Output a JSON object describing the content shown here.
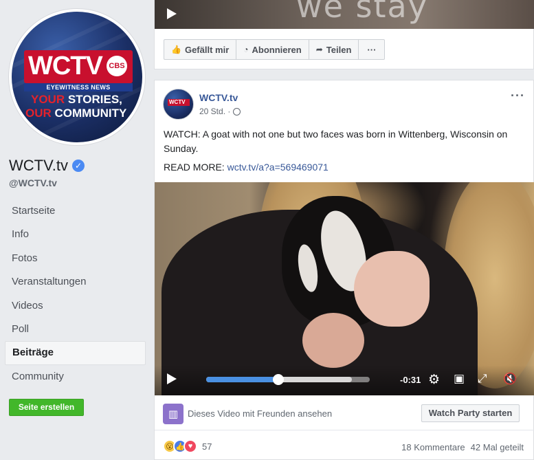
{
  "sidebar": {
    "logo": {
      "brand": "WCTV",
      "network": "CBS",
      "subtitle": "EYEWITNESS NEWS",
      "tagline_1_accent": "YOUR",
      "tagline_1_rest": " STORIES,",
      "tagline_2_accent": "OUR",
      "tagline_2_rest": " COMMUNITY"
    },
    "page_name": "WCTV.tv",
    "handle": "@WCTV.tv",
    "nav": [
      {
        "label": "Startseite"
      },
      {
        "label": "Info"
      },
      {
        "label": "Fotos"
      },
      {
        "label": "Veranstaltungen"
      },
      {
        "label": "Videos"
      },
      {
        "label": "Poll"
      },
      {
        "label": "Beiträge",
        "active": true
      },
      {
        "label": "Community"
      }
    ],
    "create_button": "Seite erstellen"
  },
  "top_card": {
    "video_caption": "we stay",
    "actions": {
      "like": "Gefällt mir",
      "subscribe": "Abonnieren",
      "share": "Teilen",
      "more": "···"
    }
  },
  "post": {
    "author": "WCTV.tv",
    "time": "20 Std. ·",
    "more": "···",
    "text": "WATCH: A goat with not one but two faces was born in Wittenberg, Wisconsin on Sunday.",
    "read_more_label": "READ MORE: ",
    "read_more_link": "wctv.tv/a?a=569469071",
    "video": {
      "time_remaining": "-0:31",
      "progress": 0.44,
      "buffered": 0.89
    },
    "watch_party": {
      "text": "Dieses Video mit Freunden ansehen",
      "button": "Watch Party starten"
    },
    "reactions": {
      "count": "57",
      "comments": "18 Kommentare",
      "shares": "42 Mal geteilt"
    }
  },
  "colors": {
    "accent_blue": "#385898",
    "progress_blue": "#4a90e2",
    "create_green": "#42b72a",
    "brand_red": "#c8102e"
  }
}
